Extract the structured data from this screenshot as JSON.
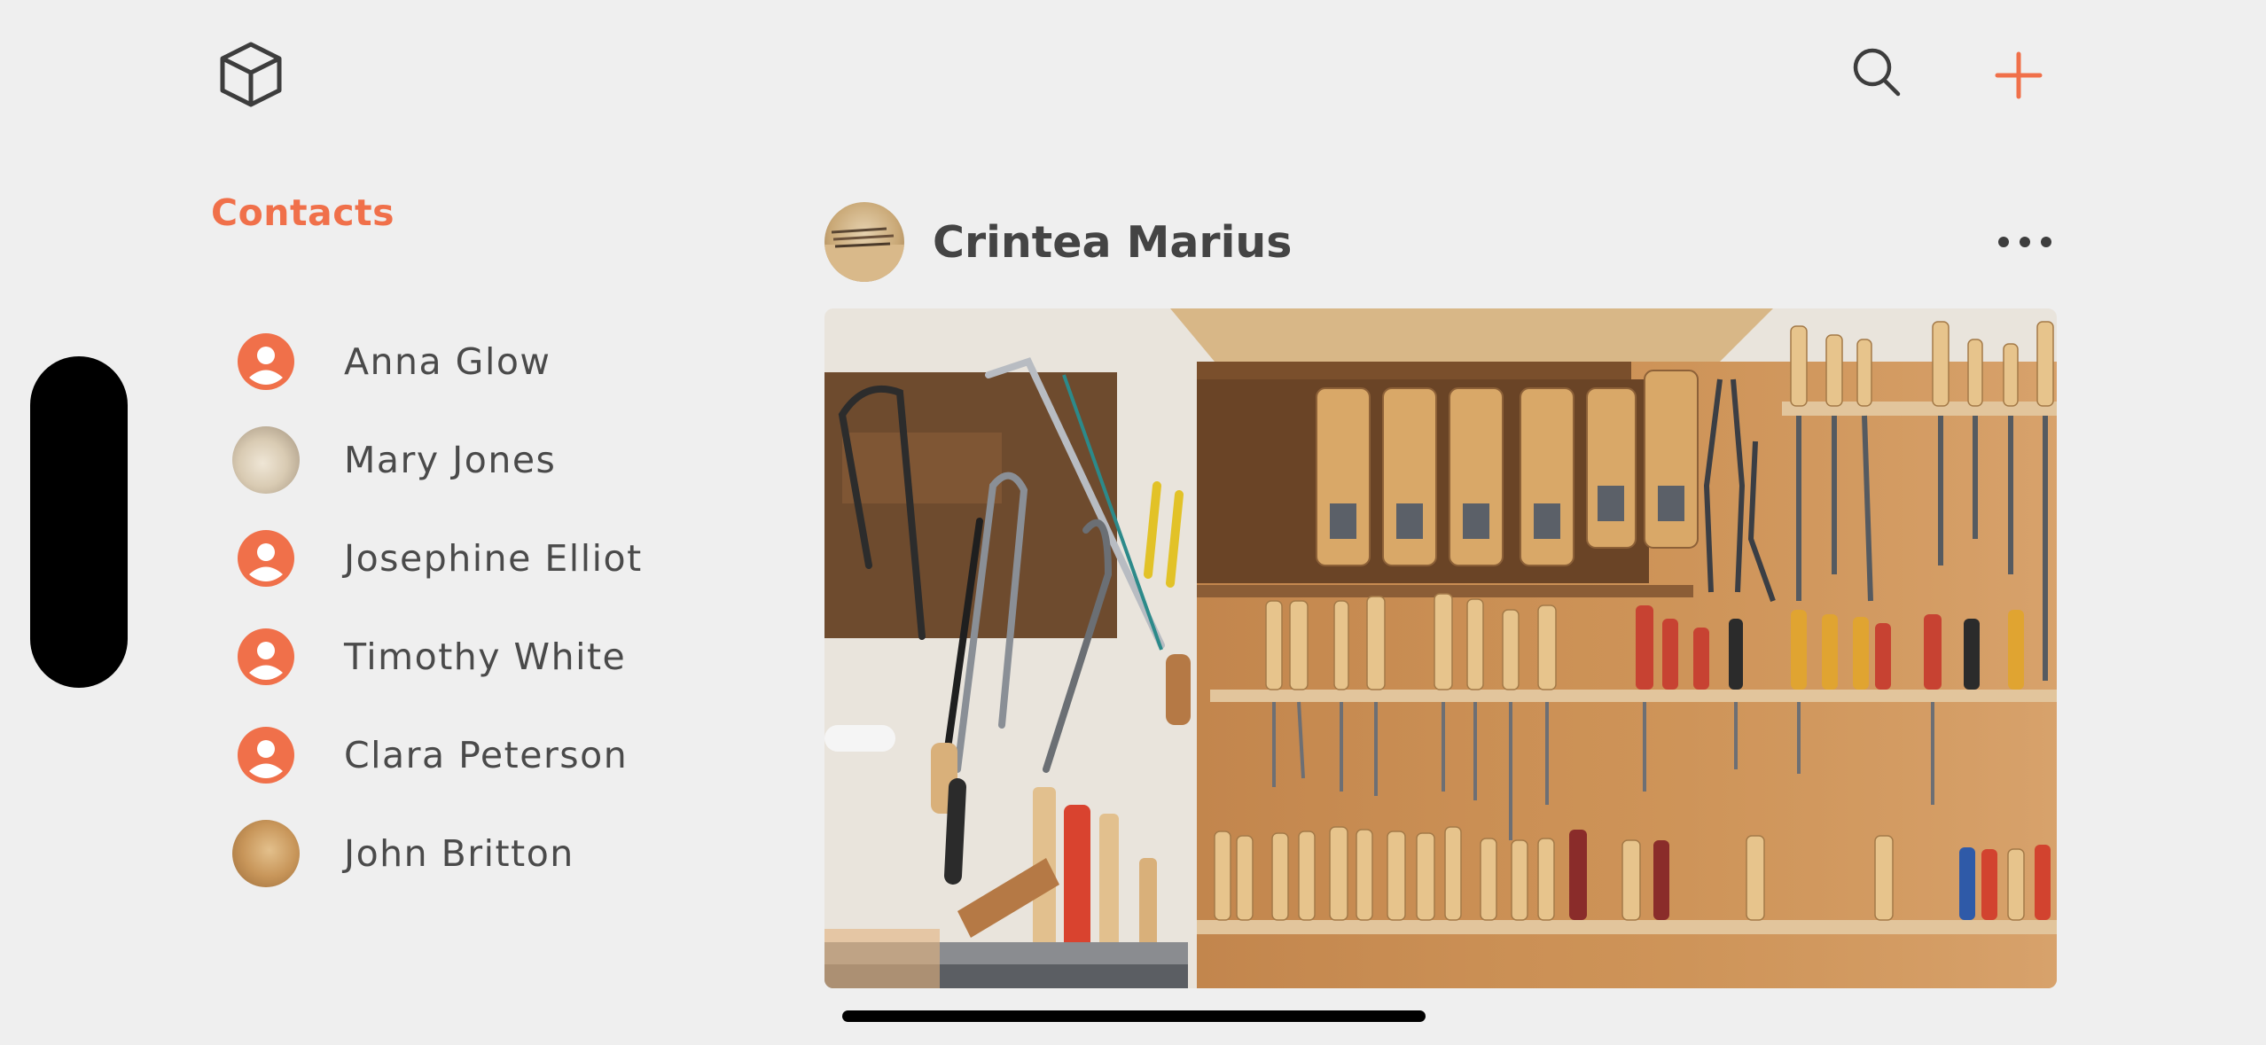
{
  "app": {
    "logo_icon": "cube-icon",
    "search_icon": "search-icon",
    "add_icon": "plus-icon",
    "accent_color": "#f0704a"
  },
  "contacts": {
    "title": "Contacts",
    "items": [
      {
        "name": "Anna Glow",
        "avatar": "person-icon"
      },
      {
        "name": "Mary Jones",
        "avatar": "photo"
      },
      {
        "name": "Josephine Elliot",
        "avatar": "person-icon"
      },
      {
        "name": "Timothy White",
        "avatar": "person-icon"
      },
      {
        "name": "Clara Peterson",
        "avatar": "person-icon"
      },
      {
        "name": "John Britton",
        "avatar": "photo"
      }
    ]
  },
  "post": {
    "author": "Crintea Marius",
    "more_icon": "more-horizontal-icon"
  }
}
